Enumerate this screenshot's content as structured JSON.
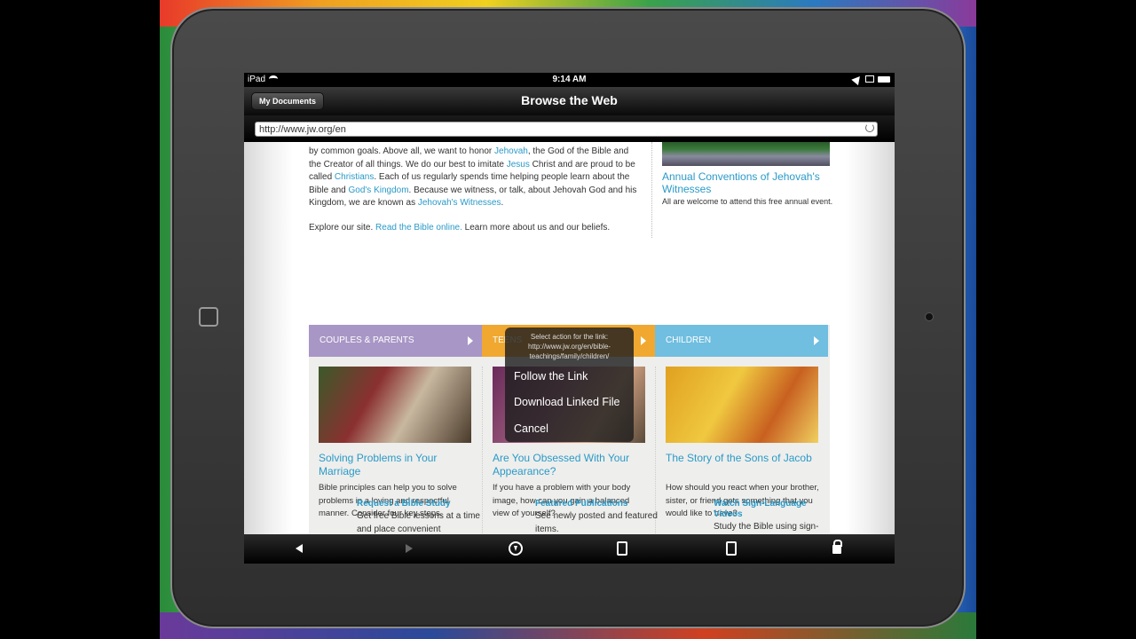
{
  "status_bar": {
    "device": "iPad",
    "time": "9:14 AM"
  },
  "nav_bar": {
    "back_label": "My Documents",
    "title": "Browse the Web"
  },
  "url_bar": {
    "url": "http://www.jw.org/en"
  },
  "page": {
    "intro": {
      "t1": "by common goals. Above all, we want to honor ",
      "jehovah": "Jehovah",
      "t2": ", the God of the Bible and the Creator of all things. We do our best to imitate ",
      "jesus": "Jesus",
      "t3": " Christ and are proud to be called ",
      "christians": "Christians",
      "t4": ". Each of us regularly spends time helping people learn about the Bible and ",
      "kingdom": "God's Kingdom",
      "t5": ". Because we witness, or talk, about Jehovah God and his Kingdom, we are known as ",
      "witnesses": "Jehovah's Witnesses",
      "t6": "."
    },
    "explore": {
      "t1": "Explore our site. ",
      "read_link": "Read the Bible online.",
      "t2": " Learn more about us and our beliefs."
    },
    "convention": {
      "title": "Annual Conventions of Jehovah's Witnesses",
      "desc": "All are welcome to attend this free annual event."
    },
    "cards": [
      {
        "header": "COUPLES & PARENTS",
        "title": "Solving Problems in Your Marriage",
        "desc": "Bible principles can help you to solve problems in a loving and respectful manner. Consider four key steps."
      },
      {
        "header": "TEENS",
        "title": "Are You Obsessed With Your Appearance?",
        "desc": "If you have a problem with your body image, how can you gain a balanced view of yourself?"
      },
      {
        "header": "CHILDREN",
        "title": "The Story of the Sons of Jacob",
        "desc": "How should you react when your brother, sister, or friend gets something that you would like to have?"
      }
    ],
    "footer": [
      {
        "title": "Request a Bible Study",
        "desc": "Get free Bible lessons at a time and place convenient"
      },
      {
        "title": "Featured Publications",
        "desc": "See newly posted and featured items."
      },
      {
        "title": "Watch Sign-Language Videos",
        "desc": "Study the Bible using sign-"
      }
    ]
  },
  "popover": {
    "header": "Select action for the link: http://www.jw.org/en/bible-teachings/family/children/",
    "items": [
      "Follow the Link",
      "Download Linked File",
      "Cancel"
    ]
  },
  "toolbar": {
    "icons": [
      "back-arrow-icon",
      "forward-arrow-icon",
      "download-icon",
      "open-in-icon",
      "save-icon",
      "lock-icon"
    ]
  },
  "colors": {
    "link": "#2a9ac8",
    "couples": "#a896c6",
    "teens": "#f0a830",
    "children": "#70bee0"
  }
}
